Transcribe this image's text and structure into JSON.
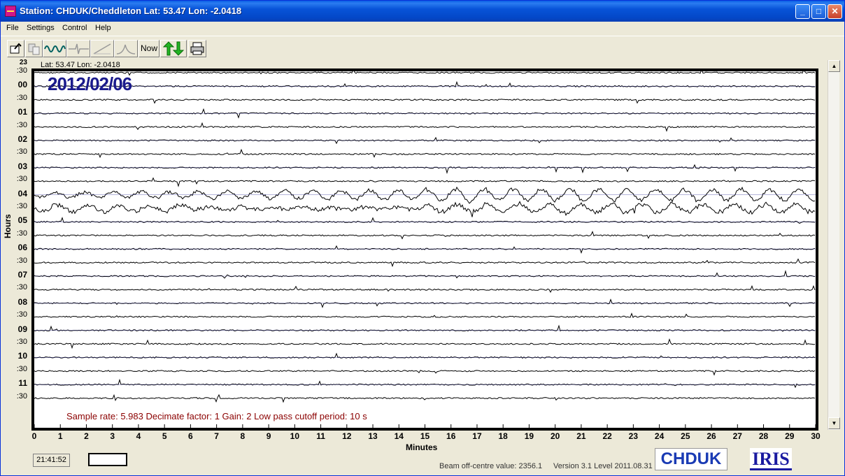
{
  "window": {
    "title": "Station: CHDUK/Cheddleton Lat: 53.47 Lon: -2.0418",
    "minimize": "_",
    "maximize": "□",
    "close": "✕"
  },
  "menu": [
    "File",
    "Settings",
    "Control",
    "Help"
  ],
  "toolbar": {
    "now_label": "Now",
    "icons": [
      "open-icon",
      "copy-icon",
      "wave-icon",
      "trace-icon",
      "ramp-icon",
      "filter-icon",
      "now-button",
      "up-down-arrows-icon",
      "print-icon"
    ]
  },
  "plot": {
    "date": "2012/02/06",
    "latlon": "Lat: 53.47 Lon: -2.0418",
    "info": "Sample rate: 5.983  Decimate factor: 1  Gain: 2  Low pass cutoff period: 10 s",
    "y_axis_title": "Hours",
    "x_axis_title": "Minutes",
    "row_labels": [
      ":30",
      "00",
      ":30",
      "01",
      ":30",
      "02",
      ":30",
      "03",
      ":30",
      "04",
      ":30",
      "05",
      ":30",
      "06",
      ":30",
      "07",
      ":30",
      "08",
      ":30",
      "09",
      ":30",
      "10",
      ":30",
      "11",
      ":30"
    ],
    "minute_ticks": [
      "0",
      "1",
      "2",
      "3",
      "4",
      "5",
      "6",
      "7",
      "8",
      "9",
      "10",
      "11",
      "12",
      "13",
      "14",
      "15",
      "16",
      "17",
      "18",
      "19",
      "20",
      "21",
      "22",
      "23",
      "24",
      "25",
      "26",
      "27",
      "28",
      "29",
      "30"
    ],
    "top_partial_label": "23"
  },
  "status": {
    "time": "21:41:52",
    "beam": "Beam off-centre value: 2356.1",
    "version": "Version 3.1 Level 2011.08.31",
    "station_logo": "CHDUK",
    "iris_logo": "IRIS"
  },
  "colors": {
    "trace": "#000000",
    "trace_blue": "#1a1a8c",
    "info_text": "#8b0000",
    "date_text": "#1a1a8c"
  },
  "chart_data": {
    "type": "line",
    "title": "2012/02/06",
    "xlabel": "Minutes",
    "ylabel": "Hours",
    "xlim": [
      0,
      30
    ],
    "rows": 25,
    "event": {
      "start_row": ":30 (04)",
      "end_row": "05",
      "description_shown": "large amplitude oscillations"
    }
  }
}
